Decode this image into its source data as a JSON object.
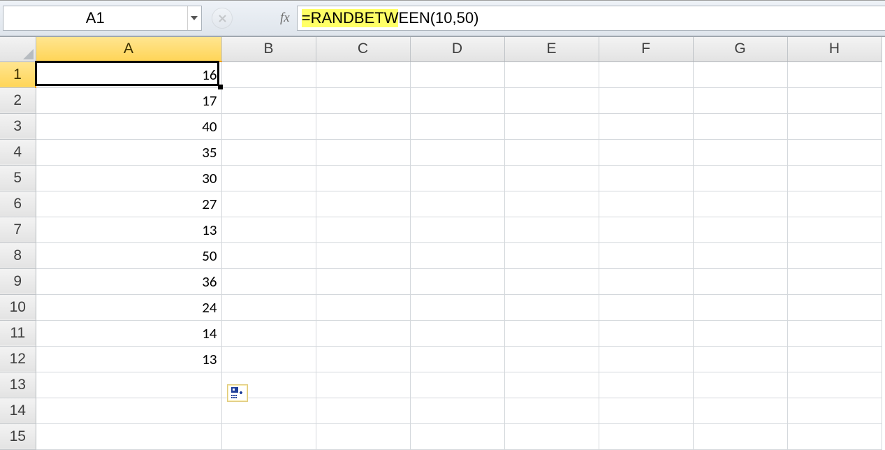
{
  "namebox": {
    "value": "A1"
  },
  "formula_bar": {
    "highlighted": "=RANDBETW",
    "rest": "EEN(10,50)"
  },
  "fx_label": "fx",
  "columns": [
    {
      "id": "A",
      "label": "A",
      "selected": true,
      "width_class": "colA"
    },
    {
      "id": "B",
      "label": "B",
      "selected": false,
      "width_class": "reg"
    },
    {
      "id": "C",
      "label": "C",
      "selected": false,
      "width_class": "reg"
    },
    {
      "id": "D",
      "label": "D",
      "selected": false,
      "width_class": "reg"
    },
    {
      "id": "E",
      "label": "E",
      "selected": false,
      "width_class": "reg"
    },
    {
      "id": "F",
      "label": "F",
      "selected": false,
      "width_class": "reg"
    },
    {
      "id": "G",
      "label": "G",
      "selected": false,
      "width_class": "reg"
    },
    {
      "id": "H",
      "label": "H",
      "selected": false,
      "width_class": "reg"
    }
  ],
  "rows": [
    {
      "n": 1,
      "selected": true,
      "A": "16"
    },
    {
      "n": 2,
      "selected": false,
      "A": "17"
    },
    {
      "n": 3,
      "selected": false,
      "A": "40"
    },
    {
      "n": 4,
      "selected": false,
      "A": "35"
    },
    {
      "n": 5,
      "selected": false,
      "A": "30"
    },
    {
      "n": 6,
      "selected": false,
      "A": "27"
    },
    {
      "n": 7,
      "selected": false,
      "A": "13"
    },
    {
      "n": 8,
      "selected": false,
      "A": "50"
    },
    {
      "n": 9,
      "selected": false,
      "A": "36"
    },
    {
      "n": 10,
      "selected": false,
      "A": "24"
    },
    {
      "n": 11,
      "selected": false,
      "A": "14"
    },
    {
      "n": 12,
      "selected": false,
      "A": "13"
    },
    {
      "n": 13,
      "selected": false,
      "A": ""
    },
    {
      "n": 14,
      "selected": false,
      "A": ""
    },
    {
      "n": 15,
      "selected": false,
      "A": ""
    }
  ],
  "icons": {
    "autofill_options": "autofill-options-icon"
  }
}
